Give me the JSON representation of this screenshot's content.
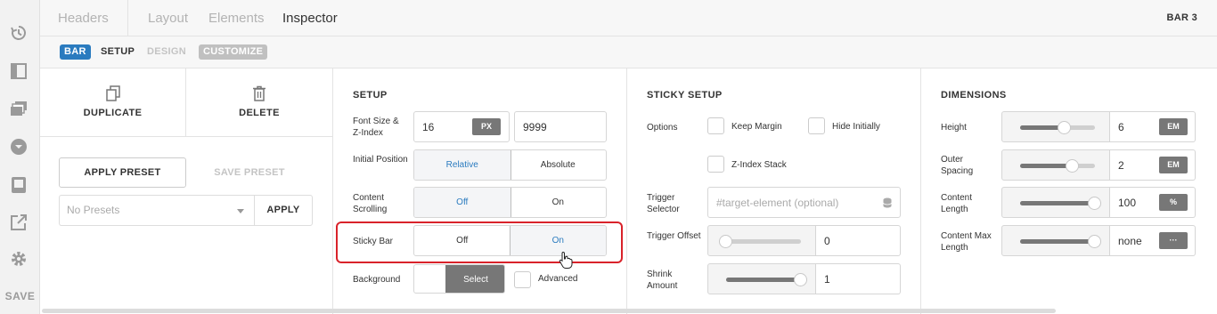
{
  "topbar": {
    "tabs": [
      "Headers",
      "Layout",
      "Elements",
      "Inspector"
    ],
    "active": "Inspector",
    "bar_name": "BAR 3"
  },
  "subbar": {
    "bar": "BAR",
    "setup": "SETUP",
    "design": "DESIGN",
    "customize": "CUSTOMIZE"
  },
  "rail": {
    "icons": [
      "history-icon",
      "panel-icon",
      "layers-icon",
      "chevron-circle-icon",
      "device-icon",
      "external-link-icon",
      "gear-icon"
    ],
    "save_label": "SAVE"
  },
  "actions": {
    "duplicate": "DUPLICATE",
    "delete": "DELETE",
    "apply_preset": "APPLY PRESET",
    "save_preset": "SAVE PRESET",
    "preset_value": "No Presets",
    "apply": "APPLY"
  },
  "setup": {
    "title": "SETUP",
    "font_size_label": "Font Size & Z-Index",
    "font_size": "16",
    "font_unit": "PX",
    "z_index": "9999",
    "initial_position_label": "Initial Position",
    "initial_position_options": [
      "Relative",
      "Absolute"
    ],
    "content_scrolling_label": "Content Scrolling",
    "content_scrolling_options": [
      "Off",
      "On"
    ],
    "sticky_bar_label": "Sticky Bar",
    "sticky_bar_options": [
      "Off",
      "On"
    ],
    "background_label": "Background",
    "background_select": "Select",
    "advanced_label": "Advanced"
  },
  "sticky": {
    "title": "STICKY SETUP",
    "options_label": "Options",
    "keep_margin": "Keep Margin",
    "hide_initially": "Hide Initially",
    "z_index_stack": "Z-Index Stack",
    "trigger_selector_label": "Trigger Selector",
    "trigger_selector_placeholder": "#target-element (optional)",
    "trigger_offset_label": "Trigger Offset",
    "trigger_offset": "0",
    "trigger_offset_level": 0,
    "shrink_amount_label": "Shrink Amount",
    "shrink_amount": "1",
    "shrink_amount_level": 1
  },
  "dimensions": {
    "title": "DIMENSIONS",
    "height_label": "Height",
    "height": "6",
    "height_unit": "EM",
    "height_level": 0.6,
    "outer_spacing_label": "Outer Spacing",
    "outer_spacing": "2",
    "outer_spacing_unit": "EM",
    "outer_spacing_level": 0.7,
    "content_length_label": "Content Length",
    "content_length": "100",
    "content_length_unit": "%",
    "content_length_level": 1,
    "content_max_label": "Content Max Length",
    "content_max": "none",
    "content_max_unit": "···",
    "content_max_level": 1
  }
}
